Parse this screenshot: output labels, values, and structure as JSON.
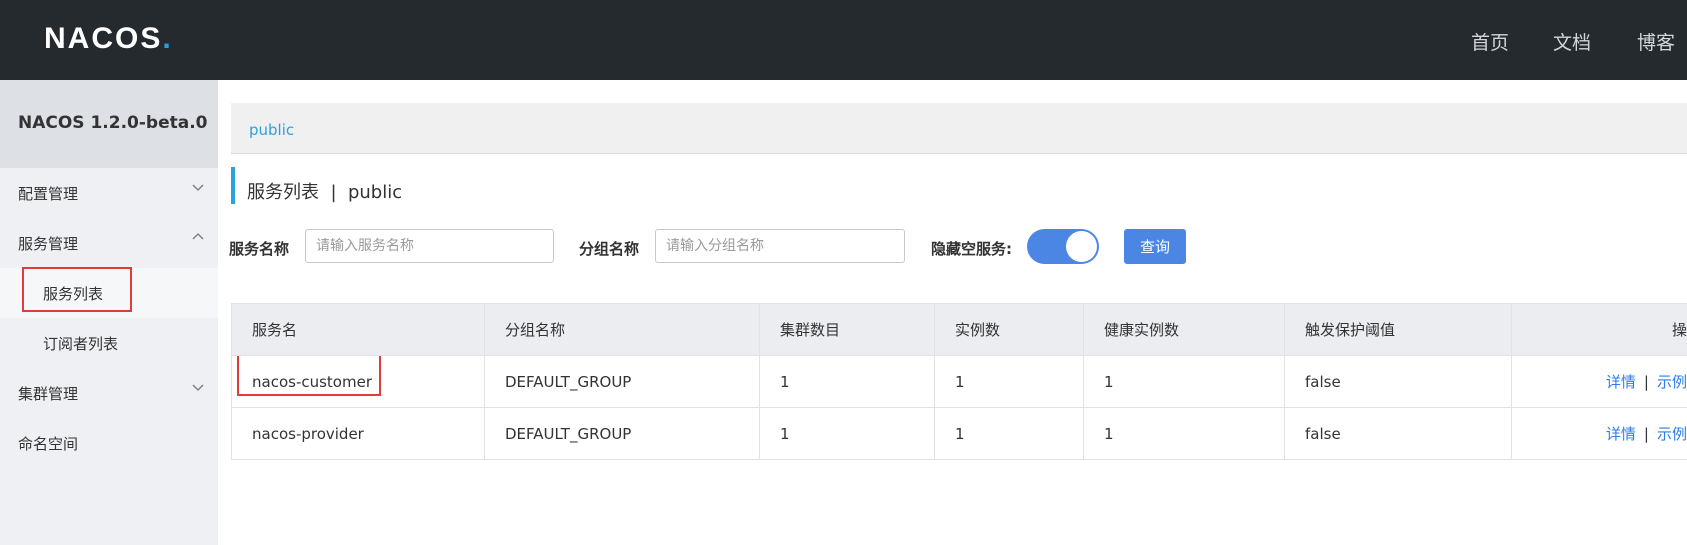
{
  "header": {
    "logo_text": "NACOS",
    "logo_dot": ".",
    "nav": [
      "首页",
      "文档",
      "博客"
    ]
  },
  "sidebar": {
    "version": "NACOS 1.2.0-beta.0",
    "items": [
      {
        "label": "配置管理",
        "chevron": "chevron-down"
      },
      {
        "label": "服务管理",
        "chevron": "chevron-up"
      },
      {
        "label": "服务列表"
      },
      {
        "label": "订阅者列表"
      },
      {
        "label": "集群管理",
        "chevron": "chevron-down"
      },
      {
        "label": "命名空间"
      }
    ]
  },
  "breadcrumb": "public",
  "page_title": "服务列表  |  public",
  "filters": {
    "service_name_label": "服务名称",
    "service_name_placeholder": "请输入服务名称",
    "group_name_label": "分组名称",
    "group_name_placeholder": "请输入分组名称",
    "hide_empty_label": "隐藏空服务:",
    "query_button": "查询"
  },
  "table": {
    "columns": [
      "服务名",
      "分组名称",
      "集群数目",
      "实例数",
      "健康实例数",
      "触发保护阈值",
      "操"
    ],
    "rows": [
      {
        "name": "nacos-customer",
        "group": "DEFAULT_GROUP",
        "clusters": "1",
        "instances": "1",
        "healthy": "1",
        "threshold": "false",
        "op_detail": "详情",
        "op_sep": "|",
        "op_example": "示例"
      },
      {
        "name": "nacos-provider",
        "group": "DEFAULT_GROUP",
        "clusters": "1",
        "instances": "1",
        "healthy": "1",
        "threshold": "false",
        "op_detail": "详情",
        "op_sep": "|",
        "op_example": "示例"
      }
    ]
  },
  "colors": {
    "header_bg": "#252a2f",
    "accent": "#2aa2d8",
    "primary_button": "#4b86e4",
    "highlight_box": "#e23b3b"
  }
}
